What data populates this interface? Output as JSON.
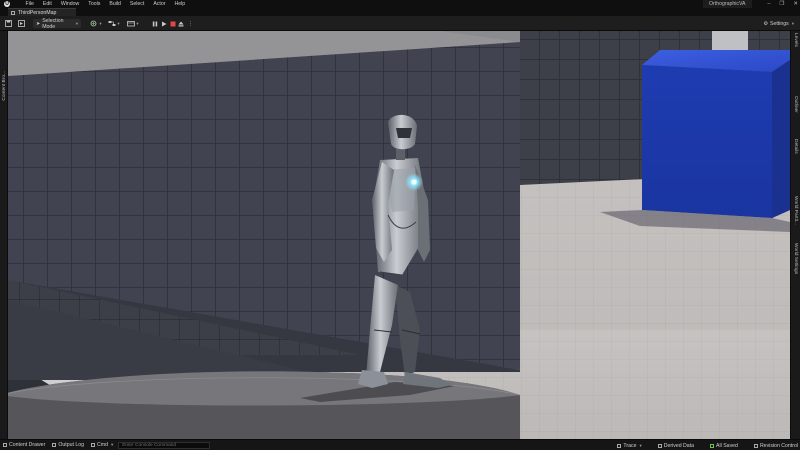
{
  "menu": {
    "items": [
      "File",
      "Edit",
      "Window",
      "Tools",
      "Build",
      "Select",
      "Actor",
      "Help"
    ]
  },
  "project_name": "OrthographicVA",
  "window_controls": [
    "–",
    "❐",
    "✕"
  ],
  "level_tab": {
    "label": "ThirdPersonMap"
  },
  "toolbar": {
    "selection_mode": "Selection Mode",
    "settings_label": "Settings"
  },
  "side_panels": {
    "left": "Content Bro...",
    "right": [
      "Levels",
      "Outliner",
      "Details",
      "World Partit...",
      "World Settings"
    ]
  },
  "statusbar": {
    "content_drawer": "Content Drawer",
    "output_log": "Output Log",
    "cmd_label": "Cmd",
    "cmd_placeholder": "Enter Console Command",
    "trace": "Trace",
    "derived_data": "Derived Data",
    "all_saved": "All Saved",
    "revision_control": "Revision Control"
  },
  "colors": {
    "cube_blue": "#1f3fb8",
    "accent_orange": "#d9a84a",
    "status_green": "#6fbf4d",
    "chest_glow": "#8fe8ff"
  },
  "icons": [
    "engine-logo-icon",
    "save-icon",
    "create-icon",
    "blueprint-icon",
    "cinematics-icon",
    "pause-icon",
    "play-icon",
    "stop-icon",
    "eject-icon",
    "settings-icon",
    "content-drawer-icon",
    "output-log-icon",
    "cmd-icon",
    "trace-icon",
    "derived-data-icon",
    "save-all-icon",
    "revision-control-icon"
  ]
}
